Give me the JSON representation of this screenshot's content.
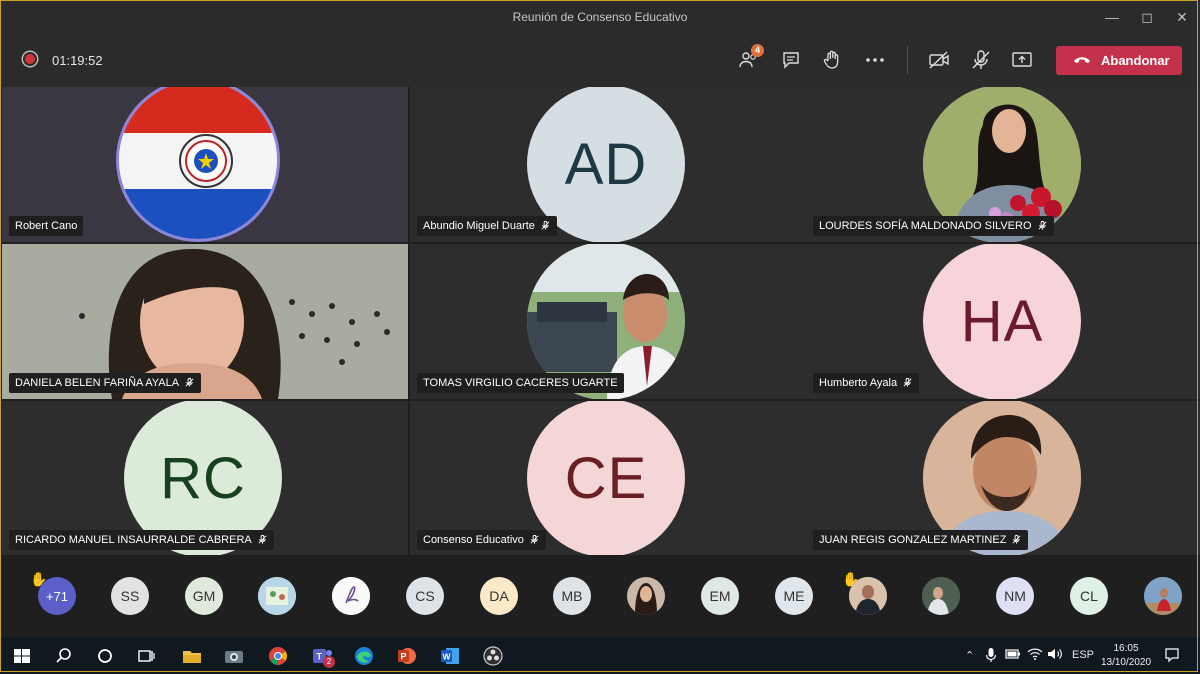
{
  "window": {
    "title": "Reunión de Consenso Educativo"
  },
  "toolbar": {
    "timer": "01:19:52",
    "participants_badge": "4",
    "leave_label": "Abandonar"
  },
  "tiles": [
    {
      "name": "Robert Cano",
      "type": "flag"
    },
    {
      "name": "Abundio Miguel Duarte",
      "initials": "AD",
      "type": "initials"
    },
    {
      "name": "LOURDES SOFÍA MALDONADO SILVERO",
      "type": "photo"
    },
    {
      "name": "DANIELA BELEN FARIÑA AYALA",
      "type": "video"
    },
    {
      "name": "TOMAS VIRGILIO CACERES UGARTE",
      "type": "photo"
    },
    {
      "name": "Humberto Ayala",
      "initials": "HA",
      "type": "initials"
    },
    {
      "name": "RICARDO MANUEL INSAURRALDE CABRERA",
      "initials": "RC",
      "type": "initials"
    },
    {
      "name": "Consenso Educativo",
      "initials": "CE",
      "type": "initials"
    },
    {
      "name": "JUAN REGIS GONZALEZ MARTINEZ",
      "type": "photo"
    }
  ],
  "strip": {
    "overflow_count": "+71",
    "chips": [
      "SS",
      "GM",
      "",
      "",
      "CS",
      "DA",
      "MB",
      "",
      "EM",
      "ME",
      "",
      "",
      "NM",
      "CL",
      ""
    ]
  },
  "taskbar": {
    "language": "ESP",
    "time": "16:05",
    "date": "13/10/2020",
    "teams_badge": "2"
  },
  "colors": {
    "leave_red": "#c4314b",
    "tile_bg": "#2d2d2d",
    "recording_red": "#d13438"
  }
}
